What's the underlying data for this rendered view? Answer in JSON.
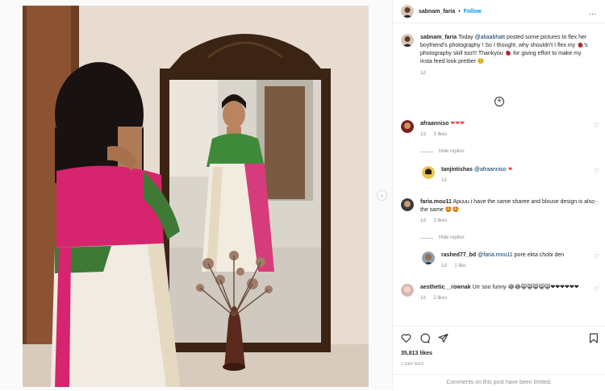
{
  "header": {
    "username": "sabnam_faria",
    "separator": "•",
    "follow_label": "Follow",
    "more_icon": "…"
  },
  "media": {
    "next_icon": "›"
  },
  "caption": {
    "username": "sabnam_faria",
    "text_before": "Today",
    "mention": "@aliaabhatt",
    "text_after": "posted some pictures to flex her boyfriend's photography ! So I thought, why shouldn't I flex my 🐞's photography skill too!!! Thankyou 🐞 for giving effort to make my insta feed look prettier 🥺",
    "time": "1d"
  },
  "load_more_icon": "+",
  "comments": [
    {
      "username": "afraanniso",
      "text": "❤❤❤",
      "time": "1d",
      "likes": "3 likes",
      "hide_label": "Hide replies",
      "replies": [
        {
          "username": "tanjintishas",
          "mention": "@afraanniso",
          "text": "❤",
          "time": "1d"
        }
      ]
    },
    {
      "username": "faria.mou11",
      "text": "Apuuu i have the same sharee and blouse design is also the same 🤩🤩",
      "time": "1d",
      "likes": "3 likes",
      "hide_label": "Hide replies",
      "replies": [
        {
          "username": "rashed77_bd",
          "mention": "@faria.mou11",
          "text": "pore ekta chobi den",
          "time": "1d",
          "likes": "1 like"
        }
      ]
    },
    {
      "username": "aesthetic__rownak",
      "text": "Urr soo funny 😂😂😸😸😸😸😸❤❤❤❤❤❤",
      "time": "1d",
      "likes": "2 likes"
    }
  ],
  "footer": {
    "likes": "35,813 likes",
    "ago": "1 DAY AGO",
    "limited": "Comments on this post have been limited."
  }
}
